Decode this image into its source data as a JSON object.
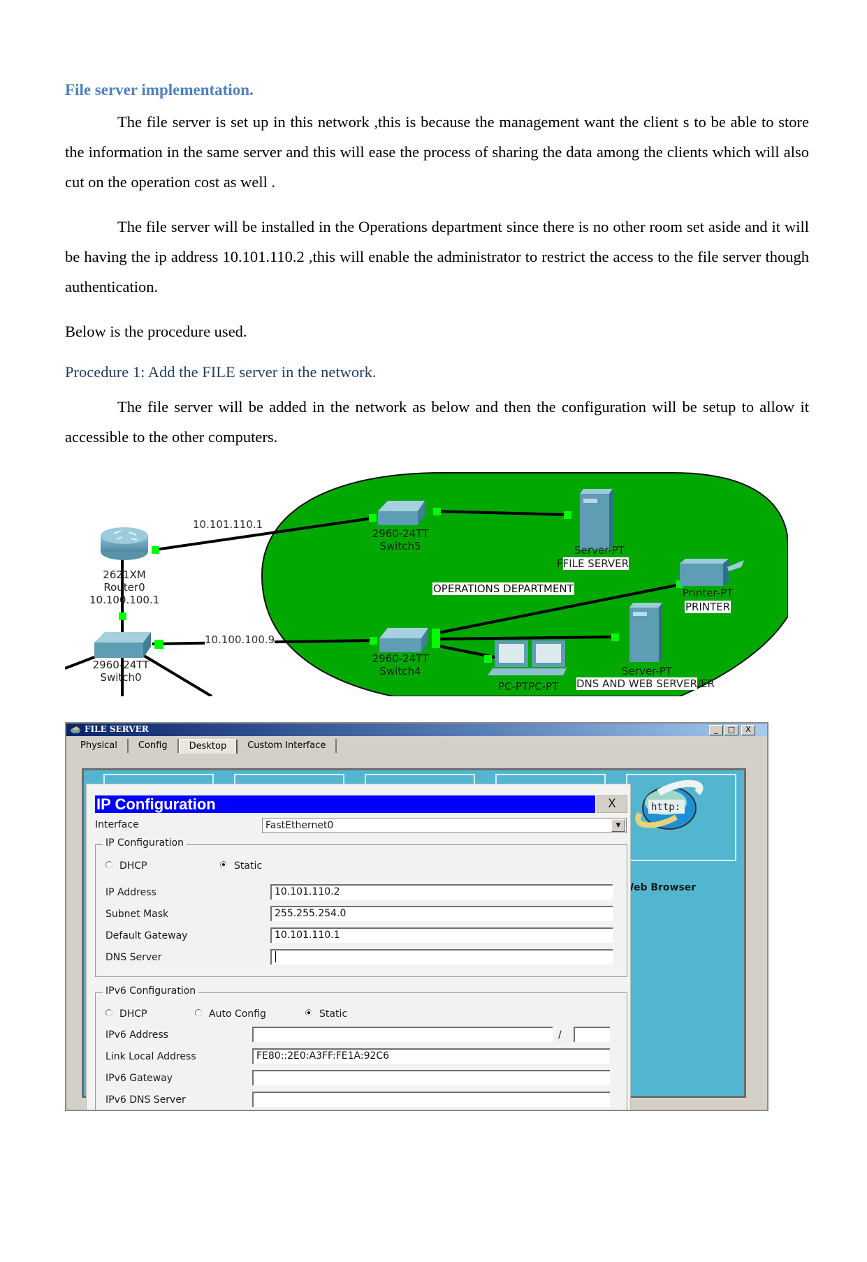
{
  "document": {
    "heading": "File server implementation.",
    "paragraphs": [
      "The file server is set up in this network ,this is because the management want the client s to be able to store the information in the same server and this will ease the process of sharing the data among the clients which will also cut on the operation cost as well .",
      "The file server will be installed in the Operations department since there is no other room set aside and it will be having the ip address 10.101.110.2 ,this will enable the administrator to restrict the access to the file server though authentication.",
      "Below is the procedure used."
    ],
    "subheading": "Procedure 1: Add the FILE server in the network.",
    "procedure_paragraph": "The file server will be added in the network as below and then the configuration will be setup to allow it accessible to the other computers."
  },
  "diagram": {
    "zone_label": "OPERATIONS DEPARTMENT",
    "zone_color": "#00a800",
    "link_color": "#00ff00",
    "link_labels": {
      "router_switch5": "10.101.110.1",
      "switch0_switch4": "10.100.100.9"
    },
    "devices": {
      "router": {
        "model": "2621XM",
        "name": "Router0",
        "ip": "10.100.100.1"
      },
      "switch0": {
        "model": "2960-24TT",
        "name": "Switch0"
      },
      "switch5": {
        "model": "2960-24TT",
        "name": "Switch5"
      },
      "switch4": {
        "model": "2960-24TT",
        "name": "Switch4"
      },
      "file_server": {
        "model": "Server-PT",
        "name": "FILE SERVER",
        "prefix": "F"
      },
      "printer": {
        "model": "Printer-PT",
        "name": "PRINTER"
      },
      "dns_web_server": {
        "model": "Server-PT",
        "name": "DNS AND WEB SERVER",
        "suffix": "/ER"
      },
      "pcs": {
        "model": "PC-PTPC-PT"
      }
    }
  },
  "pt_window": {
    "title": "FILE SERVER",
    "controls": {
      "minimize": "_",
      "maximize": "□",
      "close": "X"
    },
    "tabs": [
      {
        "label": "Physical",
        "active": false
      },
      {
        "label": "Config",
        "active": false
      },
      {
        "label": "Desktop",
        "active": true
      },
      {
        "label": "Custom Interface",
        "active": false
      }
    ],
    "desktop": {
      "browser_label": "Web Browser",
      "browser_icon_text": "http:"
    },
    "ip_config": {
      "title": "IP Configuration",
      "close_label": "X",
      "interface_label": "Interface",
      "interface_value": "FastEthernet0",
      "ipv4_group": "IP Configuration",
      "ipv4_mode_options": [
        {
          "label": "DHCP",
          "selected": false
        },
        {
          "label": "Static",
          "selected": true
        }
      ],
      "ipv4_fields": [
        {
          "label": "IP Address",
          "value": "10.101.110.2"
        },
        {
          "label": "Subnet Mask",
          "value": "255.255.254.0"
        },
        {
          "label": "Default Gateway",
          "value": "10.101.110.1"
        },
        {
          "label": "DNS Server",
          "value": ""
        }
      ],
      "ipv6_group": "IPv6 Configuration",
      "ipv6_mode_options": [
        {
          "label": "DHCP",
          "selected": false
        },
        {
          "label": "Auto Config",
          "selected": false
        },
        {
          "label": "Static",
          "selected": true
        }
      ],
      "ipv6_address_label": "IPv6 Address",
      "ipv6_address_value": "",
      "ipv6_prefix_separator": "/",
      "ipv6_prefix_value": "",
      "ipv6_fields": [
        {
          "label": "Link Local Address",
          "value": "FE80::2E0:A3FF:FE1A:92C6"
        },
        {
          "label": "IPv6 Gateway",
          "value": ""
        },
        {
          "label": "IPv6 DNS Server",
          "value": ""
        }
      ]
    }
  }
}
